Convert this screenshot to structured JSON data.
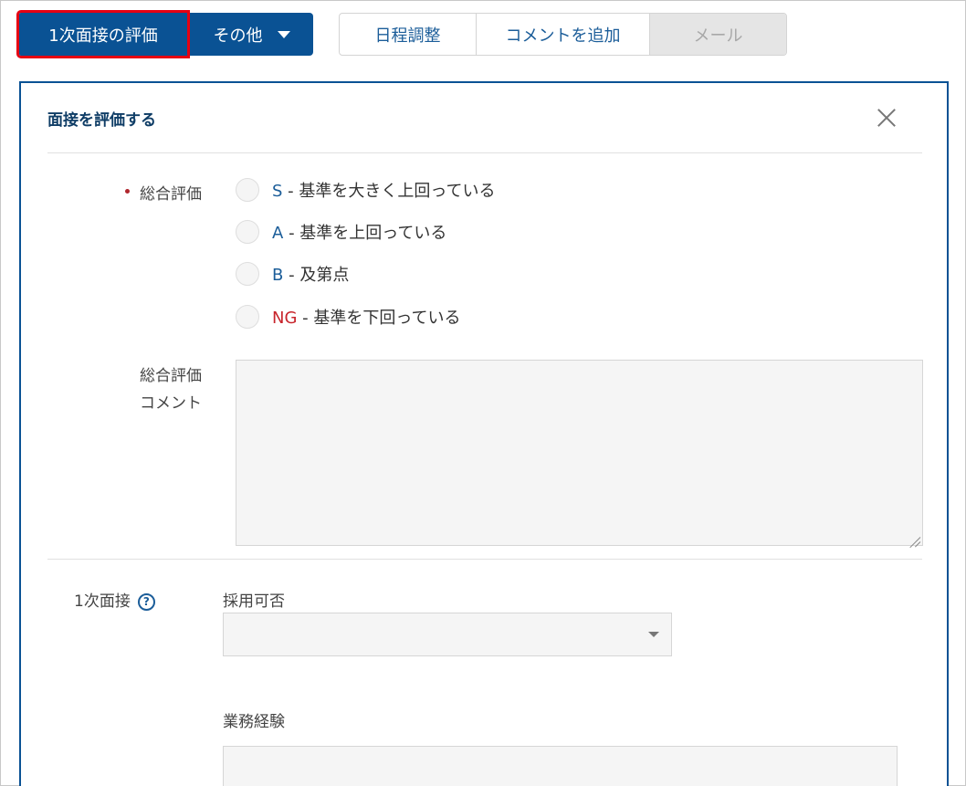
{
  "toolbar": {
    "primary_label": "1次面接の評価",
    "other_label": "その他",
    "segments": [
      "日程調整",
      "コメントを追加",
      "メール"
    ]
  },
  "panel": {
    "title": "面接を評価する",
    "overall_label": "総合評価",
    "options": [
      {
        "grade": "S",
        "separator": "-",
        "text": "基準を大きく上回っている"
      },
      {
        "grade": "A",
        "separator": "-",
        "text": "基準を上回っている"
      },
      {
        "grade": "B",
        "separator": "-",
        "text": "及第点"
      },
      {
        "grade": "NG",
        "separator": "-",
        "text": "基準を下回っている"
      }
    ],
    "comment_label_line1": "総合評価",
    "comment_label_line2": "コメント",
    "comment_value": "",
    "interview_label": "1次面接",
    "help_glyph": "?",
    "hire_label": "採用可否",
    "hire_value": "",
    "experience_label": "業務経験"
  },
  "colors": {
    "primary": "#0a5294",
    "highlight_border": "#e60012",
    "link": "#1b5d99",
    "ng": "#c8252c",
    "disabled_bg": "#e5e5e5"
  }
}
